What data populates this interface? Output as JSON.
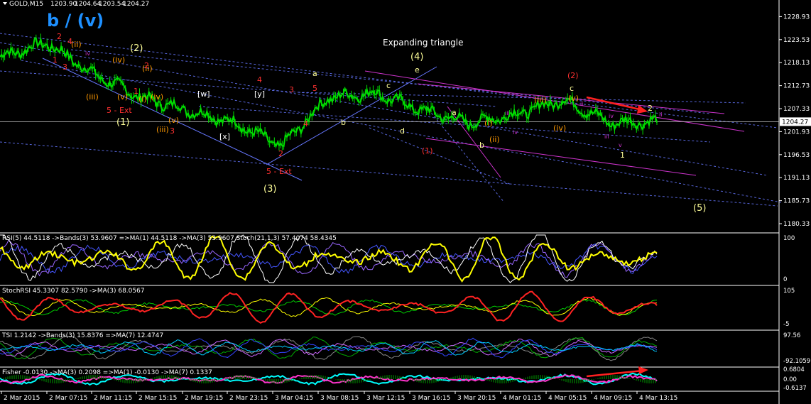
{
  "window": {
    "symbol": "GOLD,M15",
    "ohlc": [
      "1203.90",
      "1204.64",
      "1203.54",
      "1204.27"
    ],
    "main_title": "b / (v)",
    "pattern_label": "Expanding triangle",
    "current_price": "1204.27"
  },
  "colors": {
    "background": "#000000",
    "price": "#00dd00",
    "grid": "#888888",
    "wave_yellow": "#ffff99",
    "wave_red": "#ff3030",
    "wave_orange": "#ff9900",
    "wave_purple": "#cc33cc",
    "trend_blue": "#6677ff",
    "trend_magenta": "#cc33cc",
    "title_blue": "#1e90ff",
    "pointer_red": "#ff2020"
  },
  "price_axis_ticks": [
    "1228.93",
    "1223.53",
    "1218.13",
    "1212.73",
    "1207.33",
    "1201.93",
    "1196.53",
    "1191.13",
    "1185.73",
    "1180.33"
  ],
  "time_axis": [
    "2 Mar 2015",
    "2 Mar 07:15",
    "2 Mar 11:15",
    "2 Mar 15:15",
    "2 Mar 19:15",
    "2 Mar 23:15",
    "3 Mar 04:15",
    "3 Mar 08:15",
    "3 Mar 12:15",
    "3 Mar 16:15",
    "3 Mar 20:15",
    "4 Mar 01:15",
    "4 Mar 05:15",
    "4 Mar 09:15",
    "4 Mar 13:15"
  ],
  "wave_labels": [
    {
      "text": "2",
      "color": "red"
    },
    {
      "text": "1",
      "color": "red"
    },
    {
      "text": "3",
      "color": "red"
    },
    {
      "text": "4",
      "color": "red"
    },
    {
      "text": "(ii)",
      "color": "orange"
    },
    {
      "text": "iv",
      "color": "purple"
    },
    {
      "text": "(iv)",
      "color": "orange"
    },
    {
      "text": "(2)",
      "color": "yellow"
    },
    {
      "text": "(ii)",
      "color": "orange"
    },
    {
      "text": "2",
      "color": "red"
    },
    {
      "text": "(iii)",
      "color": "orange"
    },
    {
      "text": "(v)",
      "color": "orange"
    },
    {
      "text": "(i)",
      "color": "orange"
    },
    {
      "text": "1",
      "color": "red"
    },
    {
      "text": "(iv)",
      "color": "orange"
    },
    {
      "text": "5 - Ext",
      "color": "red"
    },
    {
      "text": "(1)",
      "color": "yellow"
    },
    {
      "text": "(iii)",
      "color": "orange"
    },
    {
      "text": "(v)",
      "color": "orange"
    },
    {
      "text": "3",
      "color": "red"
    },
    {
      "text": "[w]",
      "color": "white"
    },
    {
      "text": "[x]",
      "color": "white"
    },
    {
      "text": "[y]",
      "color": "white"
    },
    {
      "text": "4",
      "color": "red"
    },
    {
      "text": "2",
      "color": "red"
    },
    {
      "text": "5 - Ext",
      "color": "red"
    },
    {
      "text": "(3)",
      "color": "yellow"
    },
    {
      "text": "3",
      "color": "red"
    },
    {
      "text": "4",
      "color": "red"
    },
    {
      "text": "5",
      "color": "red"
    },
    {
      "text": "a",
      "color": "yellow"
    },
    {
      "text": "b",
      "color": "yellow"
    },
    {
      "text": "c",
      "color": "yellow"
    },
    {
      "text": "d",
      "color": "yellow"
    },
    {
      "text": "e",
      "color": "yellow"
    },
    {
      "text": "(4)",
      "color": "yellow"
    },
    {
      "text": "(1)",
      "color": "red"
    },
    {
      "text": "a",
      "color": "yellow"
    },
    {
      "text": "b",
      "color": "yellow"
    },
    {
      "text": "(i)",
      "color": "orange"
    },
    {
      "text": "(ii)",
      "color": "orange"
    },
    {
      "text": "iii",
      "color": "purple"
    },
    {
      "text": "iv",
      "color": "purple"
    },
    {
      "text": "(iii)",
      "color": "orange"
    },
    {
      "text": "(iv)",
      "color": "orange"
    },
    {
      "text": "(2)",
      "color": "red"
    },
    {
      "text": "c",
      "color": "yellow"
    },
    {
      "text": "(v)",
      "color": "orange"
    },
    {
      "text": "ii",
      "color": "purple"
    },
    {
      "text": "iv",
      "color": "purple"
    },
    {
      "text": "iii",
      "color": "purple"
    },
    {
      "text": "v",
      "color": "purple"
    },
    {
      "text": "1",
      "color": "yellow"
    },
    {
      "text": "2",
      "color": "yellow"
    },
    {
      "text": "ii",
      "color": "purple"
    },
    {
      "text": "(5)",
      "color": "yellow"
    }
  ],
  "indicators": [
    {
      "id": "rsi",
      "label": "RSI(5) 44.5118  ->Bands(3) 53.9607  =>MA(1) 44.5118  ->MA(3) 53.9607  Stoch(21,1,3) 57.4074 58.4345",
      "axis": [
        "100",
        "0"
      ]
    },
    {
      "id": "stochrsi",
      "label": "StochRSI 45.3307 82.5790  ->MA(3) 68.0567",
      "axis": [
        "105",
        "-5"
      ]
    },
    {
      "id": "tsi",
      "label": "TSI 1.2142  ->Bands(3) 15.8376  =>MA(7) 12.4747",
      "axis": [
        "97.56",
        "-92.1059"
      ]
    },
    {
      "id": "fisher",
      "label": "Fisher -0.0130  ->MA(3) 0.2098  =>MA(1) -0.0130  ->MA(7) 0.1337",
      "axis": [
        "0.6804",
        "0.00",
        "-0.6137"
      ]
    }
  ],
  "chart_data": {
    "type": "line",
    "title": "GOLD,M15",
    "ylim": [
      1178.5,
      1231.5
    ],
    "x": [
      "2 Mar 2015",
      "2 Mar 07:15",
      "2 Mar 11:15",
      "2 Mar 15:15",
      "2 Mar 19:15",
      "2 Mar 23:15",
      "3 Mar 04:15",
      "3 Mar 08:15",
      "3 Mar 12:15",
      "3 Mar 16:15",
      "3 Mar 20:15",
      "4 Mar 01:15",
      "4 Mar 05:15",
      "4 Mar 09:15",
      "4 Mar 13:15"
    ],
    "series": [
      {
        "name": "GOLD,M15",
        "values": [
          1219.5,
          1222.8,
          1215.5,
          1210.0,
          1207.0,
          1204.0,
          1198.5,
          1210.0,
          1211.0,
          1207.0,
          1204.0,
          1206.0,
          1209.5,
          1204.0,
          1204.3
        ]
      }
    ]
  }
}
